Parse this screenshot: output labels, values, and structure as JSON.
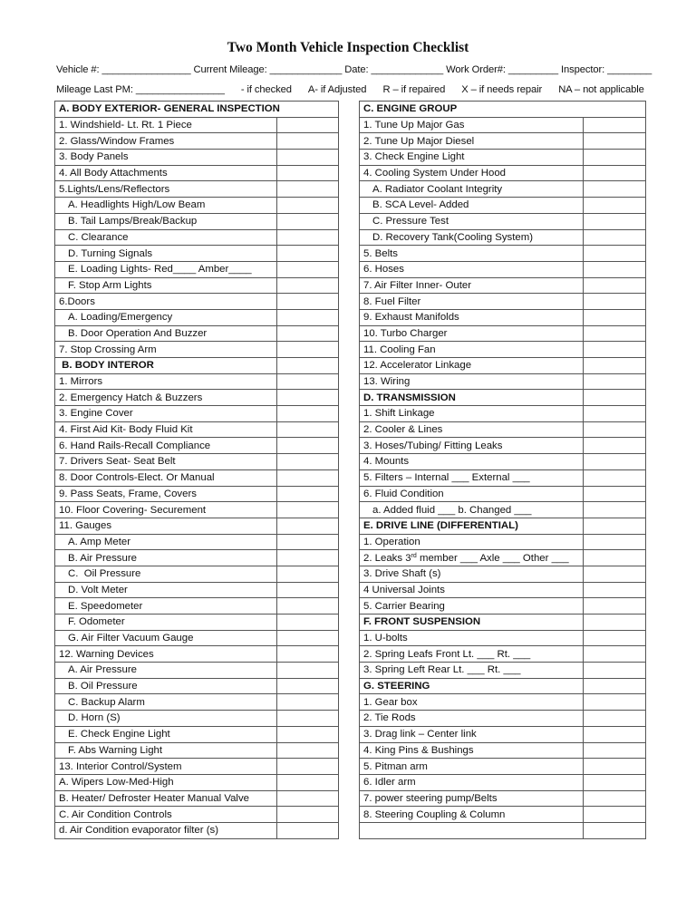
{
  "title": "Two Month Vehicle Inspection Checklist",
  "fields_row1": [
    {
      "label": "Vehicle #:",
      "blank": "________________"
    },
    {
      "label": "Current Mileage:",
      "blank": "_____________"
    },
    {
      "label": "Date:",
      "blank": "_____________"
    },
    {
      "label": "Work Order#:",
      "blank": "_________"
    },
    {
      "label": "Inspector:",
      "blank": "________"
    }
  ],
  "fields_row2": {
    "mileage_label": "Mileage Last PM:",
    "mileage_blank": "________________",
    "legend": [
      "- if checked",
      "A- if Adjusted",
      "R – if repaired",
      "X – if needs repair",
      "NA – not applicable"
    ]
  },
  "left_table": {
    "rows": [
      {
        "text": "A. BODY EXTERIOR- GENERAL INSPECTION",
        "type": "header-full"
      },
      {
        "text": "1. Windshield- Lt. Rt. 1 Piece",
        "type": "item"
      },
      {
        "text": "2. Glass/Window Frames",
        "type": "item"
      },
      {
        "text": "3. Body Panels",
        "type": "item"
      },
      {
        "text": "4. All Body Attachments",
        "type": "item"
      },
      {
        "text": "5.Lights/Lens/Reflectors",
        "type": "item"
      },
      {
        "text": "A. Headlights High/Low Beam",
        "type": "sub"
      },
      {
        "text": "B. Tail Lamps/Break/Backup",
        "type": "sub"
      },
      {
        "text": "C. Clearance",
        "type": "sub"
      },
      {
        "text": "D. Turning Signals",
        "type": "sub"
      },
      {
        "text": "E. Loading Lights- Red____ Amber____",
        "type": "sub"
      },
      {
        "text": "F. Stop Arm Lights",
        "type": "sub"
      },
      {
        "text": "6.Doors",
        "type": "item"
      },
      {
        "text": "A. Loading/Emergency",
        "type": "sub"
      },
      {
        "text": "B. Door Operation And Buzzer",
        "type": "sub"
      },
      {
        "text": "7. Stop Crossing Arm",
        "type": "item"
      },
      {
        "text": " B. BODY INTEROR",
        "type": "header"
      },
      {
        "text": "1. Mirrors",
        "type": "item"
      },
      {
        "text": "2. Emergency Hatch & Buzzers",
        "type": "item"
      },
      {
        "text": "3. Engine Cover",
        "type": "item"
      },
      {
        "text": "4. First Aid Kit- Body Fluid Kit",
        "type": "item"
      },
      {
        "text": "6. Hand Rails-Recall Compliance",
        "type": "item"
      },
      {
        "text": "7. Drivers Seat- Seat Belt",
        "type": "item"
      },
      {
        "text": "8. Door Controls-Elect. Or Manual",
        "type": "item"
      },
      {
        "text": "9. Pass Seats, Frame, Covers",
        "type": "item"
      },
      {
        "text": "10. Floor Covering- Securement",
        "type": "item"
      },
      {
        "text": "11. Gauges",
        "type": "item"
      },
      {
        "text": "A. Amp Meter",
        "type": "sub"
      },
      {
        "text": "B. Air Pressure",
        "type": "sub"
      },
      {
        "text": "C.  Oil Pressure",
        "type": "sub"
      },
      {
        "text": "D. Volt Meter",
        "type": "sub"
      },
      {
        "text": "E. Speedometer",
        "type": "sub"
      },
      {
        "text": "F. Odometer",
        "type": "sub"
      },
      {
        "text": "G. Air Filter Vacuum Gauge",
        "type": "sub"
      },
      {
        "text": "12. Warning Devices",
        "type": "item"
      },
      {
        "text": "A. Air Pressure",
        "type": "sub"
      },
      {
        "text": "B. Oil Pressure",
        "type": "sub"
      },
      {
        "text": "C. Backup Alarm",
        "type": "sub"
      },
      {
        "text": "D. Horn (S)",
        "type": "sub"
      },
      {
        "text": "E. Check Engine Light",
        "type": "sub"
      },
      {
        "text": "F. Abs Warning Light",
        "type": "sub"
      },
      {
        "text": "13. Interior Control/System",
        "type": "item"
      },
      {
        "text": "A. Wipers Low-Med-High",
        "type": "item"
      },
      {
        "text": "B. Heater/ Defroster Heater Manual Valve",
        "type": "item"
      },
      {
        "text": "C. Air Condition Controls",
        "type": "item"
      },
      {
        "text": "d. Air Condition evaporator filter (s)",
        "type": "item"
      }
    ]
  },
  "right_table": {
    "rows": [
      {
        "text": "C. ENGINE GROUP",
        "type": "header-full"
      },
      {
        "text": "1. Tune Up Major Gas",
        "type": "item"
      },
      {
        "text": "2. Tune Up Major Diesel",
        "type": "item"
      },
      {
        "text": "3. Check Engine Light",
        "type": "item"
      },
      {
        "text": "4. Cooling System Under Hood",
        "type": "item"
      },
      {
        "text": "A. Radiator Coolant Integrity",
        "type": "sub"
      },
      {
        "text": "B. SCA Level- Added",
        "type": "sub"
      },
      {
        "text": "C. Pressure Test",
        "type": "sub"
      },
      {
        "text": "D. Recovery Tank(Cooling System)",
        "type": "sub"
      },
      {
        "text": "5. Belts",
        "type": "item"
      },
      {
        "text": "6. Hoses",
        "type": "item"
      },
      {
        "text": "7. Air Filter Inner- Outer",
        "type": "item"
      },
      {
        "text": "8. Fuel Filter",
        "type": "item"
      },
      {
        "text": "9. Exhaust Manifolds",
        "type": "item"
      },
      {
        "text": "10. Turbo Charger",
        "type": "item"
      },
      {
        "text": "11. Cooling Fan",
        "type": "item"
      },
      {
        "text": "12. Accelerator Linkage",
        "type": "item"
      },
      {
        "text": "13. Wiring",
        "type": "item"
      },
      {
        "text": "D. TRANSMISSION",
        "type": "header"
      },
      {
        "text": "1. Shift Linkage",
        "type": "item"
      },
      {
        "text": "2. Cooler & Lines",
        "type": "item"
      },
      {
        "text": "3. Hoses/Tubing/ Fitting Leaks",
        "type": "item"
      },
      {
        "text": "4. Mounts",
        "type": "item"
      },
      {
        "text": "5. Filters – Internal ___ External ___",
        "type": "item"
      },
      {
        "text": "6. Fluid Condition",
        "type": "item"
      },
      {
        "text": "a. Added fluid ___ b. Changed ___",
        "type": "sub"
      },
      {
        "text": "E. DRIVE LINE (DIFFERENTIAL)",
        "type": "header"
      },
      {
        "text": "1. Operation",
        "type": "item"
      },
      {
        "text": "2. Leaks 3",
        "sup": "rd",
        "after": " member ___ Axle ___ Other ___",
        "type": "item"
      },
      {
        "text": "3. Drive Shaft (s)",
        "type": "item"
      },
      {
        "text": "4 Universal Joints",
        "type": "item"
      },
      {
        "text": "5. Carrier Bearing",
        "type": "item"
      },
      {
        "text": "F. FRONT SUSPENSION",
        "type": "header"
      },
      {
        "text": "1. U-bolts",
        "type": "item"
      },
      {
        "text": "2. Spring Leafs Front Lt. ___ Rt. ___",
        "type": "item"
      },
      {
        "text": "3. Spring Left Rear Lt. ___ Rt. ___",
        "type": "item"
      },
      {
        "text": "G. STEERING",
        "type": "header"
      },
      {
        "text": "1. Gear box",
        "type": "item"
      },
      {
        "text": "2. Tie Rods",
        "type": "item"
      },
      {
        "text": "3. Drag link – Center link",
        "type": "item"
      },
      {
        "text": "4. King Pins & Bushings",
        "type": "item"
      },
      {
        "text": "5. Pitman arm",
        "type": "item"
      },
      {
        "text": "6. Idler arm",
        "type": "item"
      },
      {
        "text": "7. power steering pump/Belts",
        "type": "item"
      },
      {
        "text": "8. Steering Coupling & Column",
        "type": "item"
      },
      {
        "text": "",
        "type": "item"
      }
    ]
  }
}
